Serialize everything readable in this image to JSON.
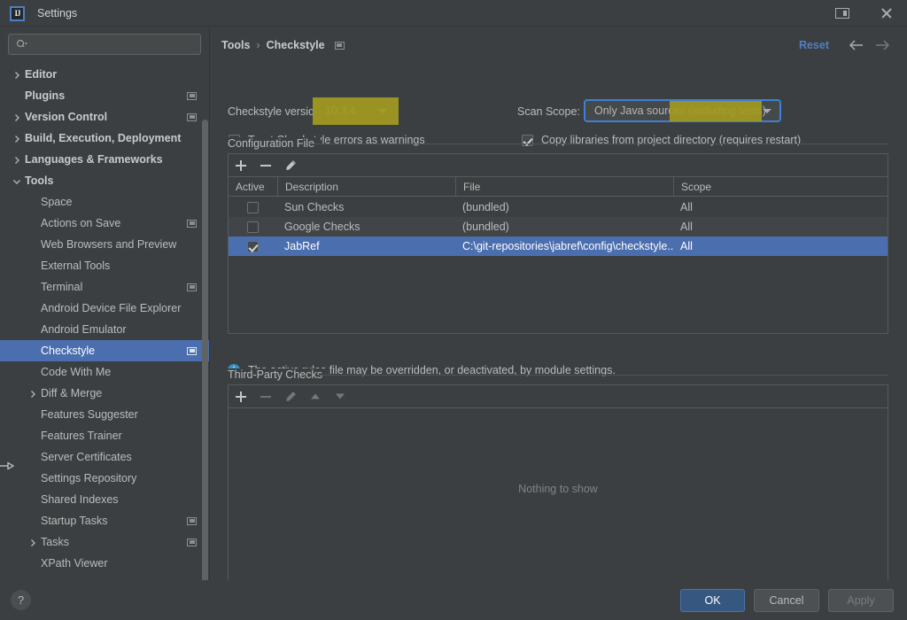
{
  "window": {
    "title": "Settings",
    "logo_text": "IJ",
    "split_icon": "split-view-icon",
    "close_icon": "close-icon"
  },
  "search": {
    "value": "",
    "placeholder": "",
    "icon": "search-icon"
  },
  "sidebar": {
    "items": [
      {
        "label": "Editor",
        "level": 0,
        "expandable": true,
        "expanded": false,
        "badge": false,
        "selected": false
      },
      {
        "label": "Plugins",
        "level": 0,
        "expandable": false,
        "expanded": false,
        "badge": true,
        "selected": false
      },
      {
        "label": "Version Control",
        "level": 0,
        "expandable": true,
        "expanded": false,
        "badge": true,
        "selected": false
      },
      {
        "label": "Build, Execution, Deployment",
        "level": 0,
        "expandable": true,
        "expanded": false,
        "badge": false,
        "selected": false
      },
      {
        "label": "Languages & Frameworks",
        "level": 0,
        "expandable": true,
        "expanded": false,
        "badge": false,
        "selected": false
      },
      {
        "label": "Tools",
        "level": 0,
        "expandable": true,
        "expanded": true,
        "badge": false,
        "selected": false
      },
      {
        "label": "Space",
        "level": 1,
        "expandable": false,
        "expanded": false,
        "badge": false,
        "selected": false
      },
      {
        "label": "Actions on Save",
        "level": 1,
        "expandable": false,
        "expanded": false,
        "badge": true,
        "selected": false
      },
      {
        "label": "Web Browsers and Preview",
        "level": 1,
        "expandable": false,
        "expanded": false,
        "badge": false,
        "selected": false
      },
      {
        "label": "External Tools",
        "level": 1,
        "expandable": false,
        "expanded": false,
        "badge": false,
        "selected": false
      },
      {
        "label": "Terminal",
        "level": 1,
        "expandable": false,
        "expanded": false,
        "badge": true,
        "selected": false
      },
      {
        "label": "Android Device File Explorer",
        "level": 1,
        "expandable": false,
        "expanded": false,
        "badge": false,
        "selected": false
      },
      {
        "label": "Android Emulator",
        "level": 1,
        "expandable": false,
        "expanded": false,
        "badge": false,
        "selected": false
      },
      {
        "label": "Checkstyle",
        "level": 1,
        "expandable": false,
        "expanded": false,
        "badge": true,
        "selected": true
      },
      {
        "label": "Code With Me",
        "level": 1,
        "expandable": false,
        "expanded": false,
        "badge": false,
        "selected": false
      },
      {
        "label": "Diff & Merge",
        "level": 1,
        "expandable": true,
        "expanded": false,
        "badge": false,
        "selected": false
      },
      {
        "label": "Features Suggester",
        "level": 1,
        "expandable": false,
        "expanded": false,
        "badge": false,
        "selected": false
      },
      {
        "label": "Features Trainer",
        "level": 1,
        "expandable": false,
        "expanded": false,
        "badge": false,
        "selected": false
      },
      {
        "label": "Server Certificates",
        "level": 1,
        "expandable": false,
        "expanded": false,
        "badge": false,
        "selected": false
      },
      {
        "label": "Settings Repository",
        "level": 1,
        "expandable": false,
        "expanded": false,
        "badge": false,
        "selected": false
      },
      {
        "label": "Shared Indexes",
        "level": 1,
        "expandable": false,
        "expanded": false,
        "badge": false,
        "selected": false
      },
      {
        "label": "Startup Tasks",
        "level": 1,
        "expandable": false,
        "expanded": false,
        "badge": true,
        "selected": false
      },
      {
        "label": "Tasks",
        "level": 1,
        "expandable": true,
        "expanded": false,
        "badge": true,
        "selected": false
      },
      {
        "label": "XPath Viewer",
        "level": 1,
        "expandable": false,
        "expanded": false,
        "badge": false,
        "selected": false
      }
    ]
  },
  "header": {
    "breadcrumb": [
      "Tools",
      "Checkstyle"
    ],
    "breadcrumb_separator": "›",
    "reset_label": "Reset",
    "back_icon": "arrow-left-icon",
    "forward_icon": "arrow-right-icon"
  },
  "main": {
    "version_label": "Checkstyle version:",
    "version_value": "10.3.4",
    "scan_scope_label": "Scan Scope:",
    "scan_scope_value": "Only Java sources (including tests)",
    "treat_errors_label": "Treat Checkstyle errors as warnings",
    "treat_errors_checked": false,
    "copy_libraries_label": "Copy libraries from project directory (requires restart)",
    "copy_libraries_checked": true,
    "config_group_title": "Configuration File",
    "config_toolbar": {
      "add_icon": "plus-icon",
      "remove_icon": "minus-icon",
      "edit_icon": "pencil-icon"
    },
    "table": {
      "columns": [
        "Active",
        "Description",
        "File",
        "Scope"
      ],
      "rows": [
        {
          "active": false,
          "description": "Sun Checks",
          "file": "(bundled)",
          "scope": "All",
          "selected": false
        },
        {
          "active": false,
          "description": "Google Checks",
          "file": "(bundled)",
          "scope": "All",
          "selected": false
        },
        {
          "active": true,
          "description": "JabRef",
          "file": "C:\\git-repositories\\jabref\\config\\checkstyle...",
          "scope": "All",
          "selected": true
        }
      ]
    },
    "info_message": "The active rules file may be overridden, or deactivated, by module settings.",
    "info_icon": "info-icon",
    "third_party_group_title": "Third-Party Checks",
    "third_party_toolbar": {
      "add_icon": "plus-icon",
      "remove_icon": "minus-icon",
      "edit_icon": "pencil-icon",
      "up_icon": "arrow-up-icon",
      "down_icon": "arrow-down-icon"
    },
    "third_party_empty": "Nothing to show"
  },
  "footer": {
    "help_icon": "question-mark-icon",
    "ok_label": "OK",
    "cancel_label": "Cancel",
    "apply_label": "Apply",
    "apply_enabled": false
  },
  "colors": {
    "window_bg": "#3c3f41",
    "selection_blue": "#4b6eaf",
    "accent_link": "#4d7fc4",
    "highlight_yellow": "#a29a21",
    "focus_border": "#3d80d6",
    "info_blue": "#3592c4",
    "primary_button": "#365880"
  }
}
